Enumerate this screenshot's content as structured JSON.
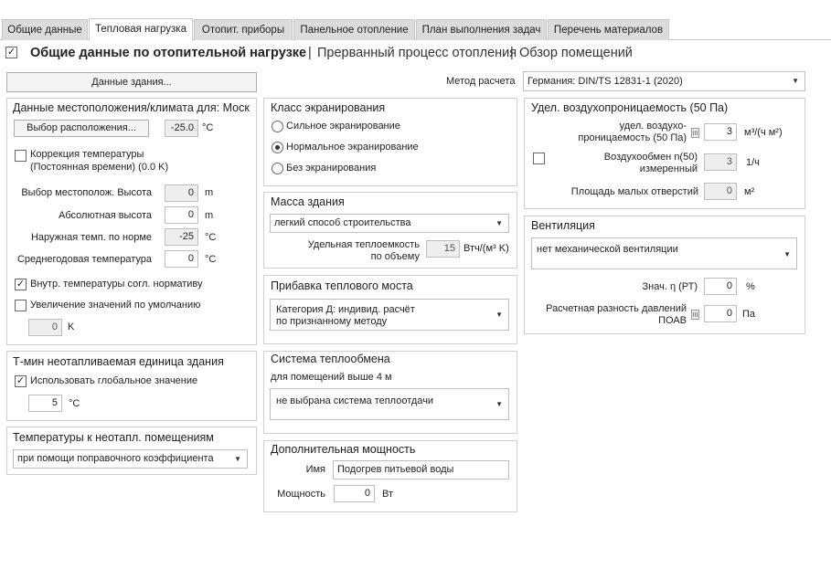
{
  "tabs": [
    "Общие данные",
    "Тепловая нагрузка",
    "Отопит. приборы",
    "Панельное отопление",
    "План выполнения задач",
    "Перечень материалов"
  ],
  "header": {
    "title": "Общие данные по отопительной нагрузке",
    "link1": "Прерванный процесс отопления",
    "link2": "Обзор помещений",
    "sep": "|"
  },
  "building_button": "Данные здания...",
  "method": {
    "label": "Метод расчета",
    "value": "Германия: DIN/TS 12831-1 (2020)"
  },
  "location": {
    "title": "Данные местоположения/климата для: Моск",
    "select_button": "Выбор расположения...",
    "temp_value": "-25.0",
    "temp_unit": "°C",
    "correction_line1": "Коррекция температуры",
    "correction_line2": "(Постоянная времени) (0.0 K)",
    "altitude_label": "Выбор местополож. Высота",
    "altitude_value": "0",
    "altitude_unit": "m",
    "abs_height_label": "Абсолютная высота",
    "abs_height_value": "0",
    "abs_height_unit": "m",
    "outdoor_label": "Наружная темп. по норме",
    "outdoor_value": "-25",
    "outdoor_unit": "°C",
    "annual_label": "Среднегодовая температура",
    "annual_value": "0",
    "annual_unit": "°C",
    "internal_norm_label": "Внутр. температуры согл. нормативу",
    "increase_label": "Увеличение значений по умолчанию",
    "increase_value": "0",
    "increase_unit": "K"
  },
  "tmin": {
    "title": "Т-мин неотапливаемая единица здания",
    "global_label": "Использовать глобальное значение",
    "value": "5",
    "unit": "°C"
  },
  "unheated": {
    "title": "Температуры к неотапл. помещениям",
    "value": "при помощи поправочного коэффициента"
  },
  "shielding": {
    "title": "Класс экранирования",
    "options": [
      "Сильное экранирование",
      "Нормальное экранирование",
      "Без экранирования"
    ],
    "selected": 1
  },
  "mass": {
    "title": "Масса здания",
    "value": "легкий способ строительства",
    "capacity_label1": "Удельная теплоемкость",
    "capacity_label2": "по объему",
    "capacity_value": "15",
    "capacity_unit": "Втч/(м³ K)"
  },
  "bridge": {
    "title": "Прибавка теплового моста",
    "value_line1": "Категория Д: индивид. расчёт",
    "value_line2": "по признанному методу"
  },
  "heat_exchange": {
    "title": "Система теплообмена",
    "subtitle": "для помещений выше 4 м",
    "value": "не выбрана система теплоотдачи"
  },
  "additional": {
    "title": "Дополнительная мощность",
    "name_label": "Имя",
    "name_value": "Подогрев питьевой воды",
    "power_label": "Мощность",
    "power_value": "0",
    "power_unit": "Вт"
  },
  "air": {
    "title": "Удел. воздухопроницаемость (50 Па)",
    "perm_label1": "удел. воздухо-",
    "perm_label2": "проницаемость (50 Па)",
    "perm_value": "3",
    "perm_unit": "м³/(ч м²)",
    "exchange_label1": "Воздухообмен n(50)",
    "exchange_label2": "измеренный",
    "exchange_value": "3",
    "exchange_unit": "1/ч",
    "holes_label": "Площадь малых отверстий",
    "holes_value": "0",
    "holes_unit": "м²"
  },
  "ventilation": {
    "title": "Вентиляция",
    "value": "нет механической вентиляции",
    "eta_label": "Знач. η (РТ)",
    "eta_value": "0",
    "eta_unit": "%",
    "pressure_label1": "Расчетная разность давлений",
    "pressure_label2": "ПОАВ",
    "pressure_value": "0",
    "pressure_unit": "Па"
  }
}
